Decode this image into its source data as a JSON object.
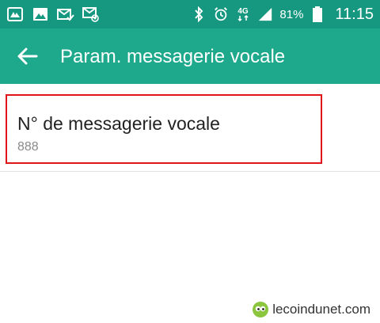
{
  "status_bar": {
    "network_type": "4G",
    "battery_percent": "81%",
    "time": "11:15",
    "icons": [
      "gallery-app-icon",
      "image-icon",
      "mail-check-icon",
      "email-at-icon",
      "bluetooth-icon",
      "alarm-icon",
      "network-4g-icon",
      "signal-icon",
      "battery-icon"
    ]
  },
  "app_bar": {
    "title": "Param. messagerie vocale"
  },
  "setting": {
    "title": "N° de messagerie vocale",
    "value": "888"
  },
  "watermark": {
    "text": "lecoindunet.com"
  },
  "colors": {
    "status_bar": "#16977f",
    "app_bar": "#1ea98c",
    "highlight": "#e1141b"
  }
}
